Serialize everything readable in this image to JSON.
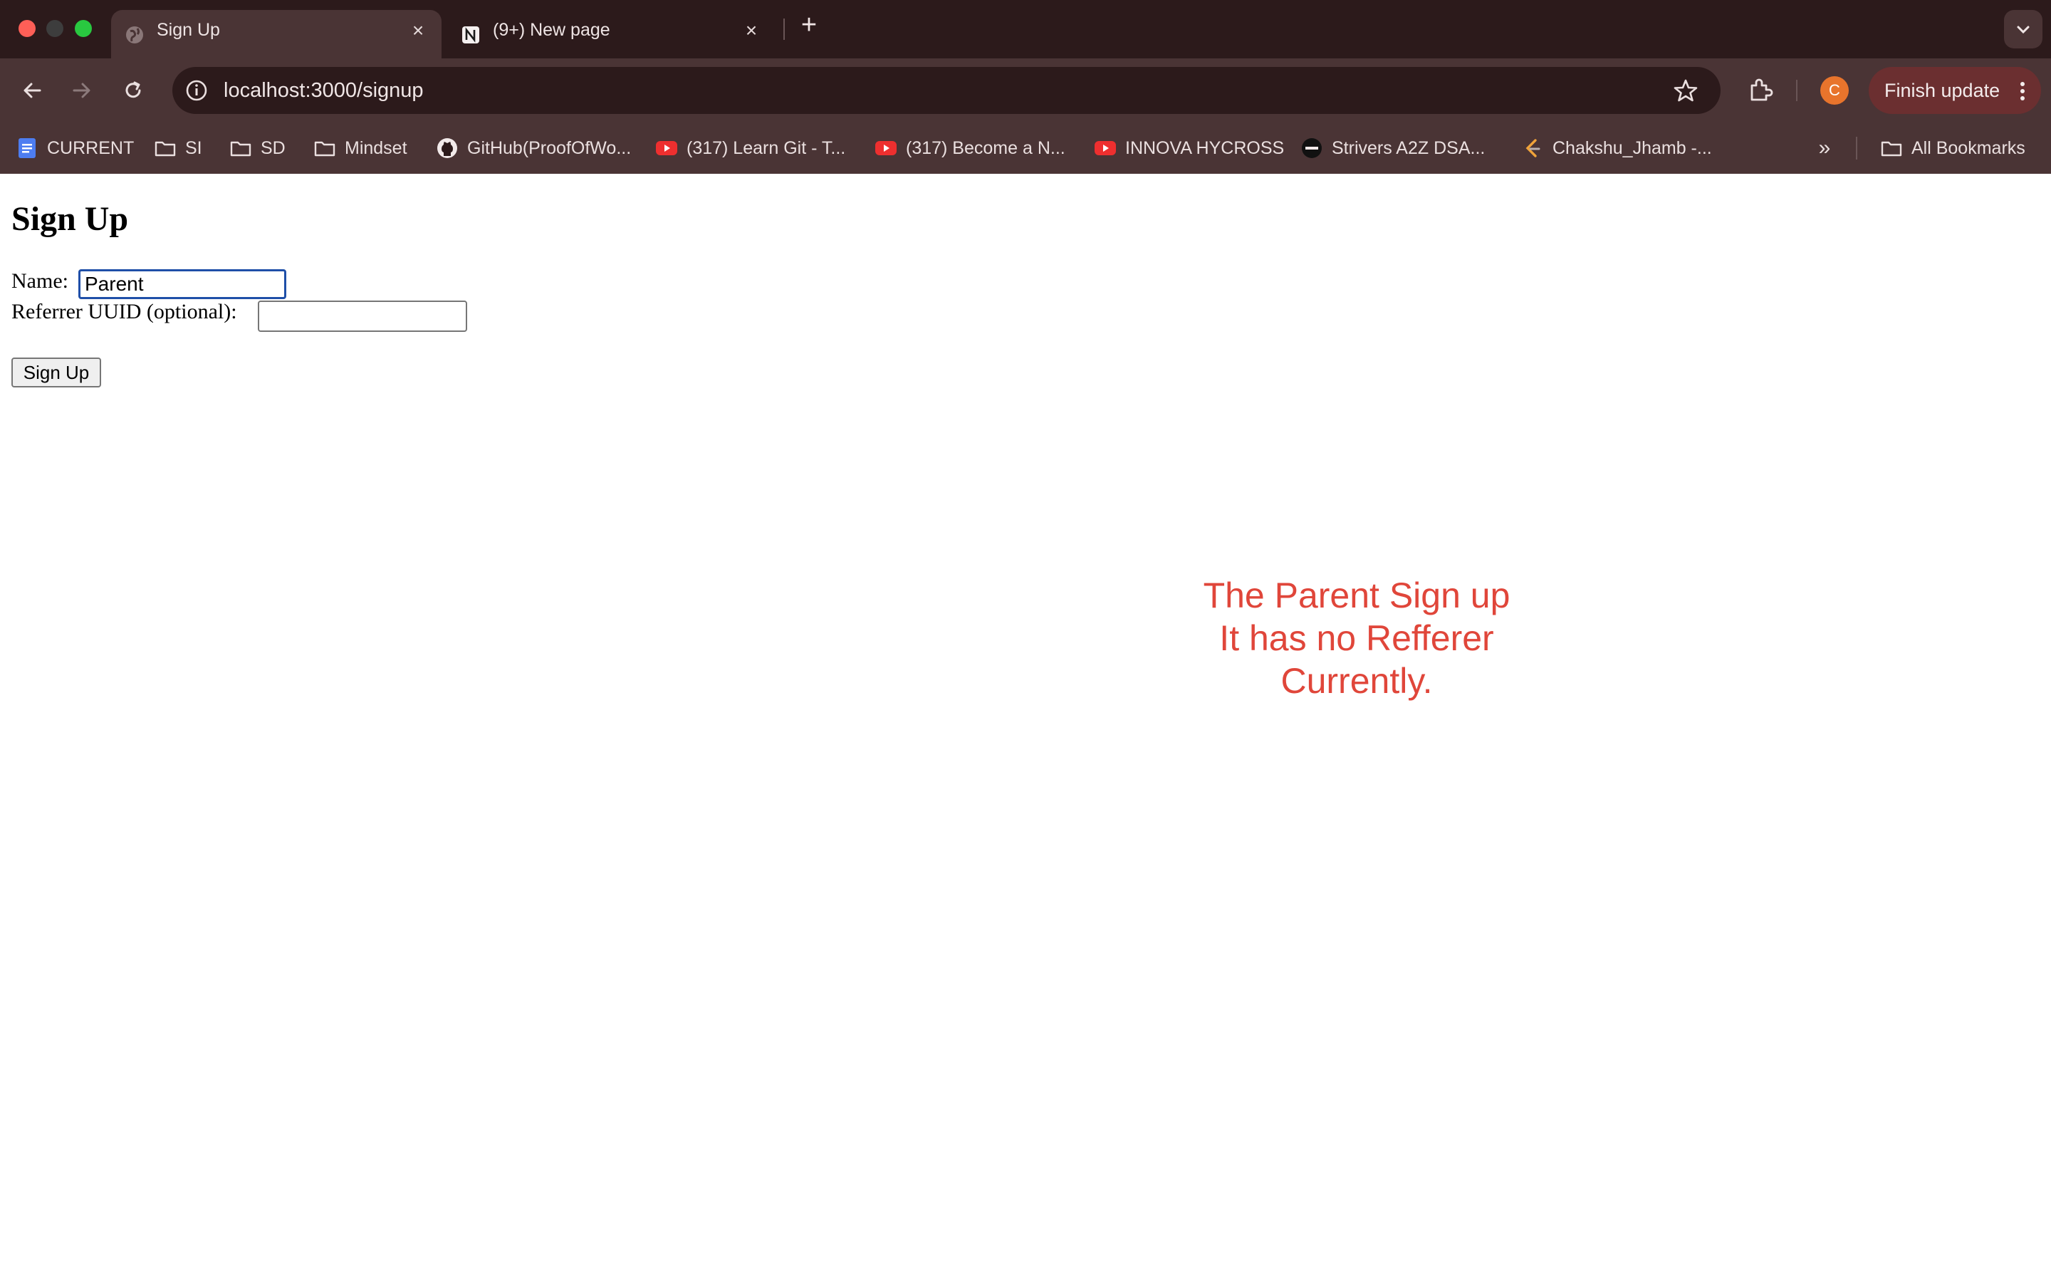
{
  "browser": {
    "tabs": [
      {
        "title": "Sign Up",
        "icon": "globe-icon",
        "active": true
      },
      {
        "title": "(9+) New page",
        "icon": "notion-icon",
        "active": false
      }
    ],
    "address_bar": {
      "url": "localhost:3000/signup"
    },
    "profile_initial": "C",
    "finish_update_label": "Finish update",
    "bookmarks": [
      {
        "label": "CURRENT",
        "icon": "docs-icon"
      },
      {
        "label": "SI",
        "icon": "folder-icon"
      },
      {
        "label": "SD",
        "icon": "folder-icon"
      },
      {
        "label": "Mindset",
        "icon": "folder-icon"
      },
      {
        "label": "GitHub(ProofOfWo...",
        "icon": "github-icon"
      },
      {
        "label": "(317) Learn Git - T...",
        "icon": "youtube-icon"
      },
      {
        "label": "(317) Become a N...",
        "icon": "youtube-icon"
      },
      {
        "label": "INNOVA HYCROSS",
        "icon": "youtube-icon"
      },
      {
        "label": "Strivers A2Z DSA...",
        "icon": "tuf-icon"
      },
      {
        "label": "Chakshu_Jhamb -...",
        "icon": "leetcode-icon"
      }
    ],
    "all_bookmarks_label": "All Bookmarks",
    "colors": {
      "tabstrip": "#2c1a1b",
      "toolbar": "#4a3435",
      "finish_update": "#6b2f30",
      "avatar": "#e8742c"
    }
  },
  "page": {
    "title": "Sign Up",
    "form": {
      "name_label": "Name:",
      "name_value": "Parent",
      "referrer_label": "Referrer UUID (optional):",
      "referrer_value": "",
      "submit_label": "Sign Up"
    },
    "annotation": {
      "lines": [
        "The Parent Sign up",
        "It has no Refferer",
        "Currently."
      ],
      "color": "#e0463a"
    }
  }
}
